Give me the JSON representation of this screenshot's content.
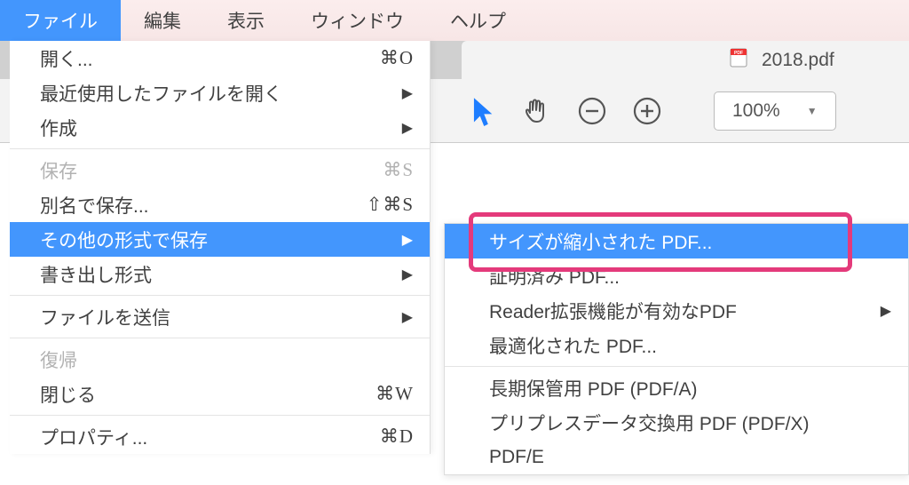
{
  "menubar": {
    "items": [
      "ファイル",
      "編集",
      "表示",
      "ウィンドウ",
      "ヘルプ"
    ],
    "activeIndex": 0
  },
  "tab": {
    "filename": "2018.pdf"
  },
  "toolbar": {
    "zoom_value": "100%"
  },
  "file_menu": {
    "items": [
      {
        "label": "開く...",
        "shortcut": "⌘O",
        "disabled": false,
        "submenu": false,
        "highlighted": false
      },
      {
        "label": "最近使用したファイルを開く",
        "shortcut": "",
        "disabled": false,
        "submenu": true,
        "highlighted": false
      },
      {
        "label": "作成",
        "shortcut": "",
        "disabled": false,
        "submenu": true,
        "highlighted": false
      },
      {
        "sep": true
      },
      {
        "label": "保存",
        "shortcut": "⌘S",
        "disabled": true,
        "submenu": false,
        "highlighted": false
      },
      {
        "label": "別名で保存...",
        "shortcut": "⇧⌘S",
        "disabled": false,
        "submenu": false,
        "highlighted": false
      },
      {
        "label": "その他の形式で保存",
        "shortcut": "",
        "disabled": false,
        "submenu": true,
        "highlighted": true
      },
      {
        "label": "書き出し形式",
        "shortcut": "",
        "disabled": false,
        "submenu": true,
        "highlighted": false
      },
      {
        "sep": true
      },
      {
        "label": "ファイルを送信",
        "shortcut": "",
        "disabled": false,
        "submenu": true,
        "highlighted": false
      },
      {
        "sep": true
      },
      {
        "label": "復帰",
        "shortcut": "",
        "disabled": true,
        "submenu": false,
        "highlighted": false
      },
      {
        "label": "閉じる",
        "shortcut": "⌘W",
        "disabled": false,
        "submenu": false,
        "highlighted": false
      },
      {
        "sep": true
      },
      {
        "label": "プロパティ...",
        "shortcut": "⌘D",
        "disabled": false,
        "submenu": false,
        "highlighted": false
      }
    ]
  },
  "save_as_submenu": {
    "items": [
      {
        "label": "サイズが縮小された PDF...",
        "submenu": false,
        "highlighted": true
      },
      {
        "label": "証明済み PDF...",
        "submenu": false,
        "highlighted": false
      },
      {
        "label": "Reader拡張機能が有効なPDF",
        "submenu": true,
        "highlighted": false
      },
      {
        "label": "最適化された PDF...",
        "submenu": false,
        "highlighted": false
      },
      {
        "sep": true
      },
      {
        "label": "長期保管用 PDF (PDF/A)",
        "submenu": false,
        "highlighted": false
      },
      {
        "label": "プリプレスデータ交換用 PDF (PDF/X)",
        "submenu": false,
        "highlighted": false
      },
      {
        "label": "PDF/E",
        "submenu": false,
        "highlighted": false
      }
    ]
  }
}
